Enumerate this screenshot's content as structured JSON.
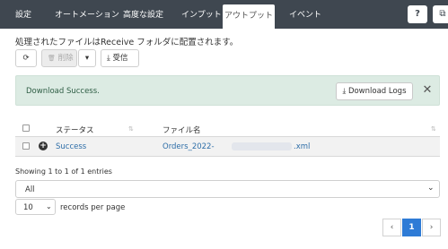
{
  "nav": {
    "tabs": [
      {
        "label": "設定"
      },
      {
        "label": "オートメーション"
      },
      {
        "label": "高度な設定"
      },
      {
        "label": "インプット"
      },
      {
        "label": "アウトプット"
      },
      {
        "label": "イベント"
      }
    ],
    "active_tab": "アウトプット",
    "help_icon": "?",
    "external_icon": "⧉"
  },
  "info_text": "処理されたファイルはReceive フォルダに配置されます。",
  "toolbar": {
    "refresh_icon": "⟳",
    "delete_icon": "🗑",
    "delete_label": "削除",
    "dropdown_icon": "▾",
    "receive_icon": "⤓",
    "receive_label": "受信"
  },
  "alert": {
    "message": "Download Success.",
    "download_logs_label": "Download Logs",
    "download_icon": "⤓",
    "close_icon": "✕"
  },
  "table": {
    "headers": {
      "status": "ステータス",
      "filename": "ファイル名"
    },
    "rows": [
      {
        "status": "Success",
        "filename_prefix": "Orders_2022-",
        "filename_suffix": ".xml"
      }
    ]
  },
  "entries_info": "Showing 1 to 1 of 1 entries",
  "filter": {
    "value": "All"
  },
  "page_length": {
    "value": "10",
    "label": "records per page"
  },
  "pagination": {
    "prev": "‹",
    "current": "1",
    "next": "›"
  }
}
